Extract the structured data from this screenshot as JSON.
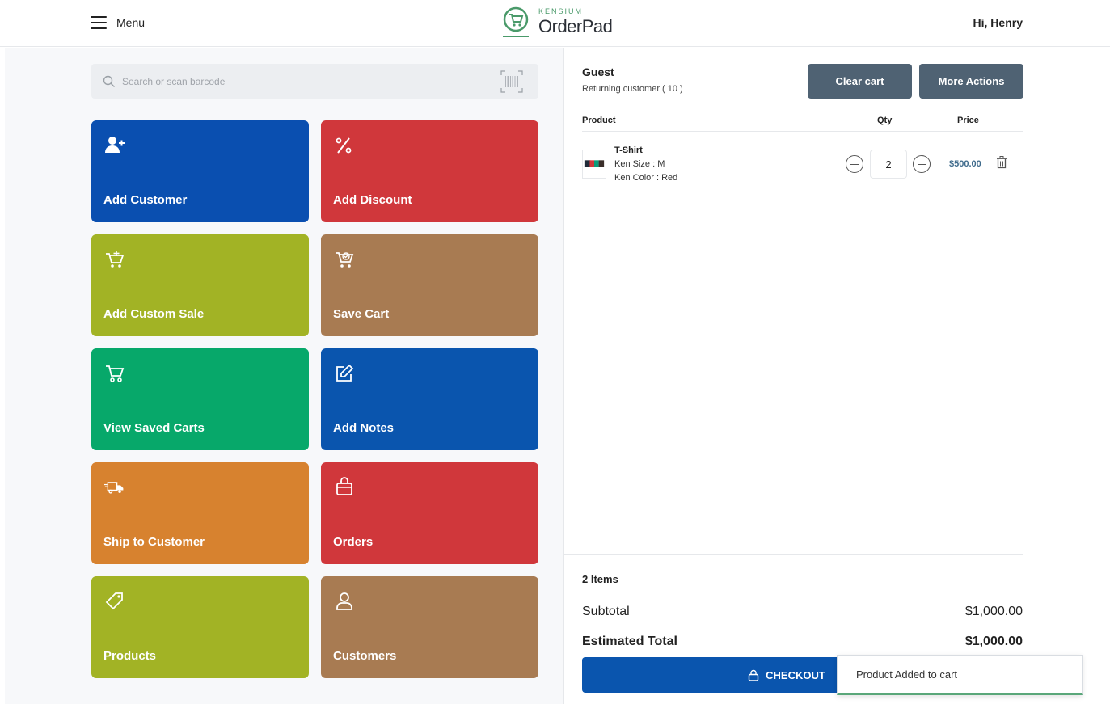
{
  "header": {
    "menu_label": "Menu",
    "logo_brand": "KENSIUM",
    "logo_name": "OrderPad",
    "greeting": "Hi, Henry"
  },
  "search": {
    "placeholder": "Search or scan barcode"
  },
  "tiles": [
    {
      "label": "Add Customer",
      "icon": "add-user-icon",
      "color": "#0a4fb0"
    },
    {
      "label": "Add Discount",
      "icon": "percent-icon",
      "color": "#d0373b"
    },
    {
      "label": "Add Custom Sale",
      "icon": "cart-plus-icon",
      "color": "#a2b325"
    },
    {
      "label": "Save Cart",
      "icon": "cart-save-icon",
      "color": "#a87b52"
    },
    {
      "label": "View Saved Carts",
      "icon": "cart-icon",
      "color": "#07a86a"
    },
    {
      "label": "Add Notes",
      "icon": "edit-icon",
      "color": "#0a55ae"
    },
    {
      "label": "Ship to Customer",
      "icon": "truck-icon",
      "color": "#d7822f"
    },
    {
      "label": "Orders",
      "icon": "bag-icon",
      "color": "#d0373b"
    },
    {
      "label": "Products",
      "icon": "tag-icon",
      "color": "#a2b325"
    },
    {
      "label": "Customers",
      "icon": "user-icon",
      "color": "#a87b52"
    }
  ],
  "cart": {
    "customer_name": "Guest",
    "customer_status": "Returning customer ( 10 )",
    "clear_label": "Clear cart",
    "more_label": "More Actions",
    "columns": {
      "product": "Product",
      "qty": "Qty",
      "price": "Price"
    },
    "items": [
      {
        "name": "T-Shirt",
        "attributes": [
          "Ken Size : M",
          "Ken Color : Red"
        ],
        "qty": "2",
        "price": "$500.00"
      }
    ],
    "item_count": "2 Items",
    "subtotal_label": "Subtotal",
    "subtotal_value": "$1,000.00",
    "total_label": "Estimated Total",
    "total_value": "$1,000.00",
    "checkout_label": "CHECKOUT"
  },
  "toast": {
    "message": "Product Added to cart"
  }
}
